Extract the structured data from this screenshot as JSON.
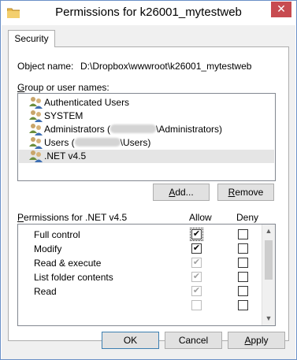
{
  "window": {
    "title": "Permissions for k26001_mytestweb",
    "close_glyph": "✕"
  },
  "tabs": [
    {
      "label": "Security"
    }
  ],
  "object": {
    "label": "Object name:",
    "value": "D:\\Dropbox\\wwwroot\\k26001_mytestweb"
  },
  "groups": {
    "label": "Group or user names:",
    "items": [
      {
        "prefix": "Authenticated Users",
        "suffix": ""
      },
      {
        "prefix": "SYSTEM",
        "suffix": ""
      },
      {
        "prefix": "Administrators (",
        "suffix": "\\Administrators)"
      },
      {
        "prefix": "Users (",
        "suffix": "\\Users)"
      },
      {
        "prefix": ".NET v4.5",
        "suffix": ""
      }
    ],
    "selected_index": 4
  },
  "buttons": {
    "add": "Add...",
    "remove": "Remove",
    "ok": "OK",
    "cancel": "Cancel",
    "apply": "Apply"
  },
  "permissions": {
    "label": "Permissions for .NET v4.5",
    "allow_header": "Allow",
    "deny_header": "Deny",
    "rows": [
      {
        "name": "Full control",
        "allow": true,
        "allow_enabled": true,
        "deny": false
      },
      {
        "name": "Modify",
        "allow": true,
        "allow_enabled": true,
        "deny": false
      },
      {
        "name": "Read & execute",
        "allow": true,
        "allow_enabled": false,
        "deny": false
      },
      {
        "name": "List folder contents",
        "allow": true,
        "allow_enabled": false,
        "deny": false
      },
      {
        "name": "Read",
        "allow": true,
        "allow_enabled": false,
        "deny": false
      }
    ]
  },
  "icons": {
    "title": "folder-icon",
    "users": "user-group-icon",
    "check": "✔"
  },
  "colors": {
    "window_border": "#6a8fc7",
    "close_button": "#c74b50",
    "selection": "#e5e5e5"
  }
}
